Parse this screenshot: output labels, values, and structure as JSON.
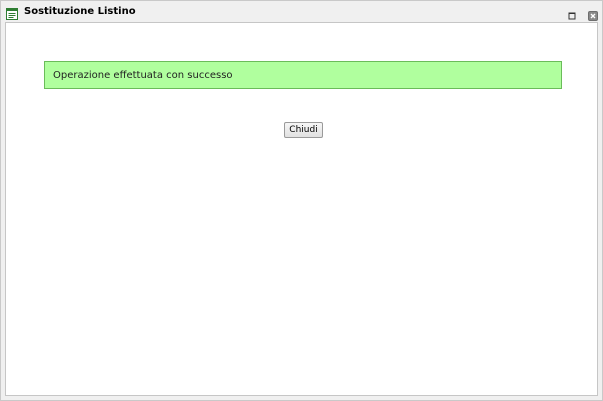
{
  "window": {
    "title": "Sostituzione Listino",
    "icon": "list-window-icon",
    "controls": [
      "maximize-icon",
      "close-icon"
    ]
  },
  "message": {
    "text": "Operazione effettuata con successo",
    "type": "success",
    "background": "#b0ff9e",
    "border": "#6abc5a"
  },
  "actions": {
    "close_label": "Chiudi"
  }
}
